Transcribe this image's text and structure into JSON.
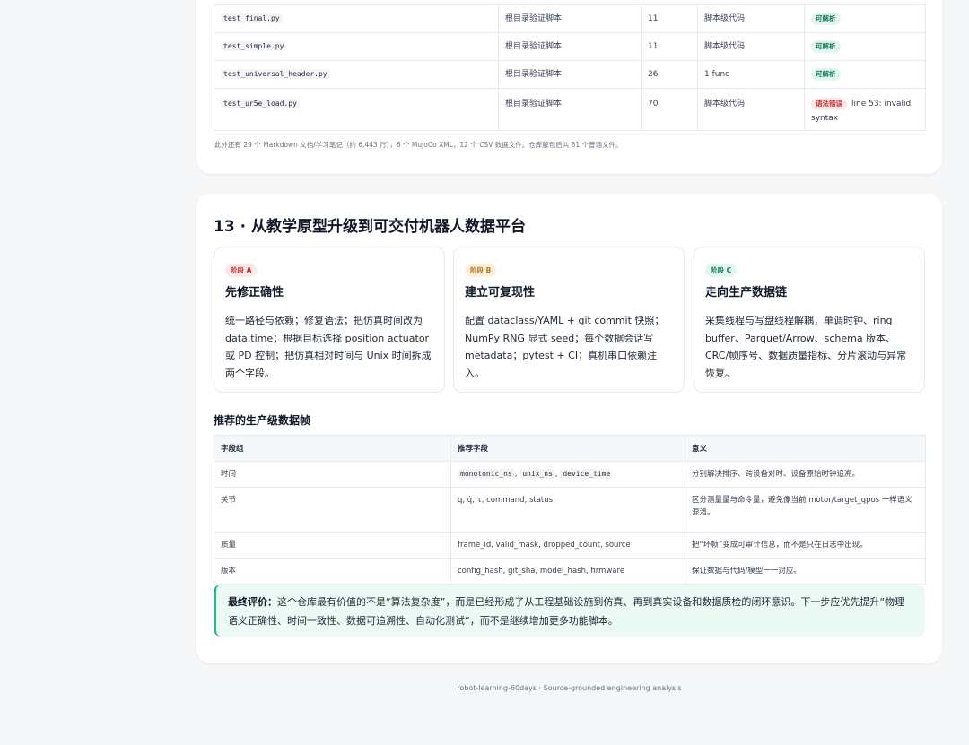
{
  "files": {
    "rows": [
      {
        "name": "test_final.py",
        "desc": "根目录验证脚本",
        "lines": "11",
        "kind": "脚本级代码",
        "status": "可解析",
        "status_type": "ok",
        "detail": ""
      },
      {
        "name": "test_simple.py",
        "desc": "根目录验证脚本",
        "lines": "11",
        "kind": "脚本级代码",
        "status": "可解析",
        "status_type": "ok",
        "detail": ""
      },
      {
        "name": "test_universal_header.py",
        "desc": "根目录验证脚本",
        "lines": "26",
        "kind": "1 func",
        "status": "可解析",
        "status_type": "ok",
        "detail": ""
      },
      {
        "name": "test_ur5e_load.py",
        "desc": "根目录验证脚本",
        "lines": "70",
        "kind": "脚本级代码",
        "status": "语法错误",
        "status_type": "err",
        "detail": "line 53: invalid syntax"
      }
    ],
    "note": "此外还有 29 个 Markdown 文档/学习笔记（约 6,443 行），6 个 MuJoCo XML，12 个 CSV 数据文件。仓库解包后共 81 个普通文件。"
  },
  "section": {
    "title": "13 · 从教学原型升级到可交付机器人数据平台",
    "stages": [
      {
        "badge": "阶段 A",
        "title": "先修正确性",
        "body": "统一路径与依赖；修复语法；把仿真时间改为 data.time；根据目标选择 position actuator 或 PD 控制；把仿真相对时间与 Unix 时间拆成两个字段。"
      },
      {
        "badge": "阶段 B",
        "title": "建立可复现性",
        "body": "配置 dataclass/YAML + git commit 快照；NumPy RNG 显式 seed；每个数据会话写 metadata；pytest + CI；真机串口依赖注入。"
      },
      {
        "badge": "阶段 C",
        "title": "走向生产数据链",
        "body": "采集线程与写盘线程解耦，单调时钟、ring buffer、Parquet/Arrow、schema 版本、CRC/帧序号、数据质量指标、分片滚动与异常恢复。"
      }
    ],
    "frame_title": "推荐的生产级数据帧",
    "frame_headers": [
      "字段组",
      "推荐字段",
      "意义"
    ],
    "frame_rows": [
      {
        "group": "时间",
        "fields": [
          "monotonic_ns",
          "unix_ns",
          "device_time"
        ],
        "fields_text": "",
        "meaning": "分别解决排序、跨设备对时、设备原始时钟追溯。"
      },
      {
        "group": "关节",
        "fields": [],
        "fields_text": "q, q̇, τ, command, status",
        "meaning": "区分测量量与命令量，避免像当前 motor/target_qpos 一样语义混淆。"
      },
      {
        "group": "质量",
        "fields": [],
        "fields_text": "frame_id, valid_mask, dropped_count, source",
        "meaning": "把“坏帧”变成可审计信息，而不是只在日志中出现。"
      },
      {
        "group": "版本",
        "fields": [],
        "fields_text": "config_hash, git_sha, model_hash, firmware",
        "meaning": "保证数据与代码/模型一一对应。"
      }
    ],
    "verdict_label": "最终评价：",
    "verdict_text": "这个仓库最有价值的不是“算法复杂度”，而是已经形成了从工程基础设施到仿真、再到真实设备和数据质检的闭环意识。下一步应优先提升“物理语义正确性、时间一致性、数据可追溯性、自动化测试”，而不是继续增加更多功能脚本。"
  },
  "footer": "robot-learning-60days · Source-grounded engineering analysis"
}
